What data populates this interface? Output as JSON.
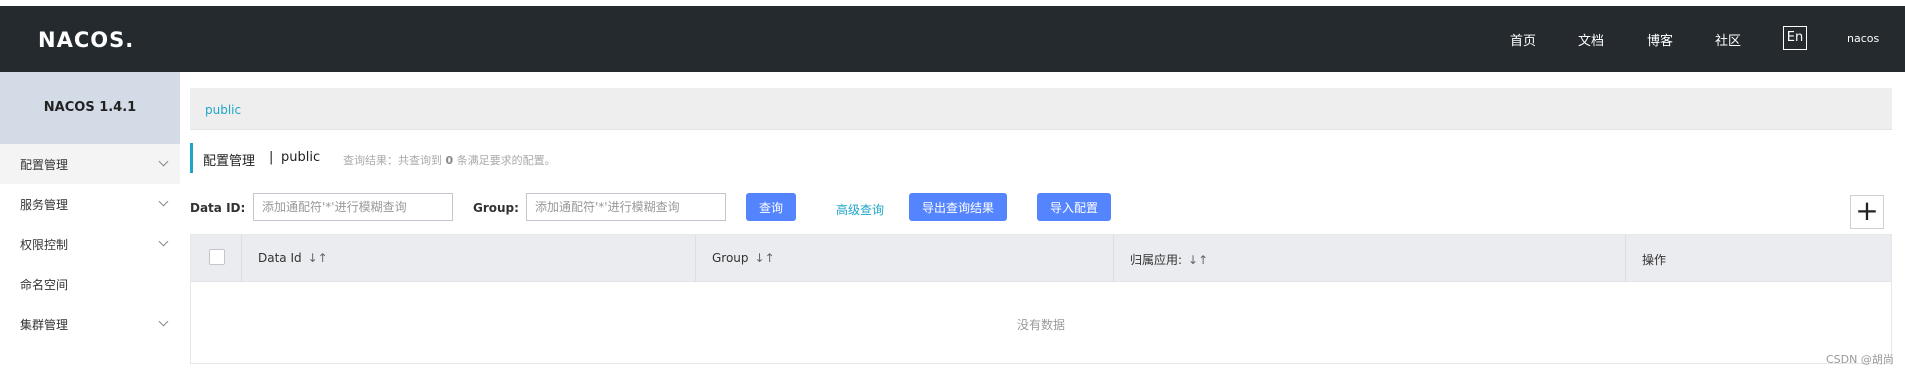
{
  "header": {
    "logo": "NACOS.",
    "nav": [
      "首页",
      "文档",
      "博客",
      "社区"
    ],
    "lang": "En",
    "user": "nacos"
  },
  "sidebar": {
    "title": "NACOS 1.4.1",
    "items": [
      {
        "label": "配置管理",
        "expandable": true
      },
      {
        "label": "服务管理",
        "expandable": true
      },
      {
        "label": "权限控制",
        "expandable": true
      },
      {
        "label": "命名空间",
        "expandable": false
      },
      {
        "label": "集群管理",
        "expandable": true
      }
    ]
  },
  "main": {
    "breadcrumb": "public",
    "title": "配置管理",
    "title_sep": "|",
    "namespace": "public",
    "result_prefix": "查询结果：共查询到",
    "result_count": "0",
    "result_suffix": "条满足要求的配置。",
    "filters": {
      "data_id_label": "Data ID:",
      "data_id_placeholder": "添加通配符'*'进行模糊查询",
      "group_label": "Group:",
      "group_placeholder": "添加通配符'*'进行模糊查询",
      "query_button": "查询",
      "advanced_query": "高级查询",
      "export_button": "导出查询结果",
      "import_button": "导入配置",
      "add_button": "+"
    },
    "table": {
      "columns": [
        "Data Id",
        "Group",
        "归属应用:",
        "操作"
      ],
      "sort_icon": "↓↑",
      "empty_text": "没有数据"
    }
  },
  "watermark": "CSDN @胡尚"
}
